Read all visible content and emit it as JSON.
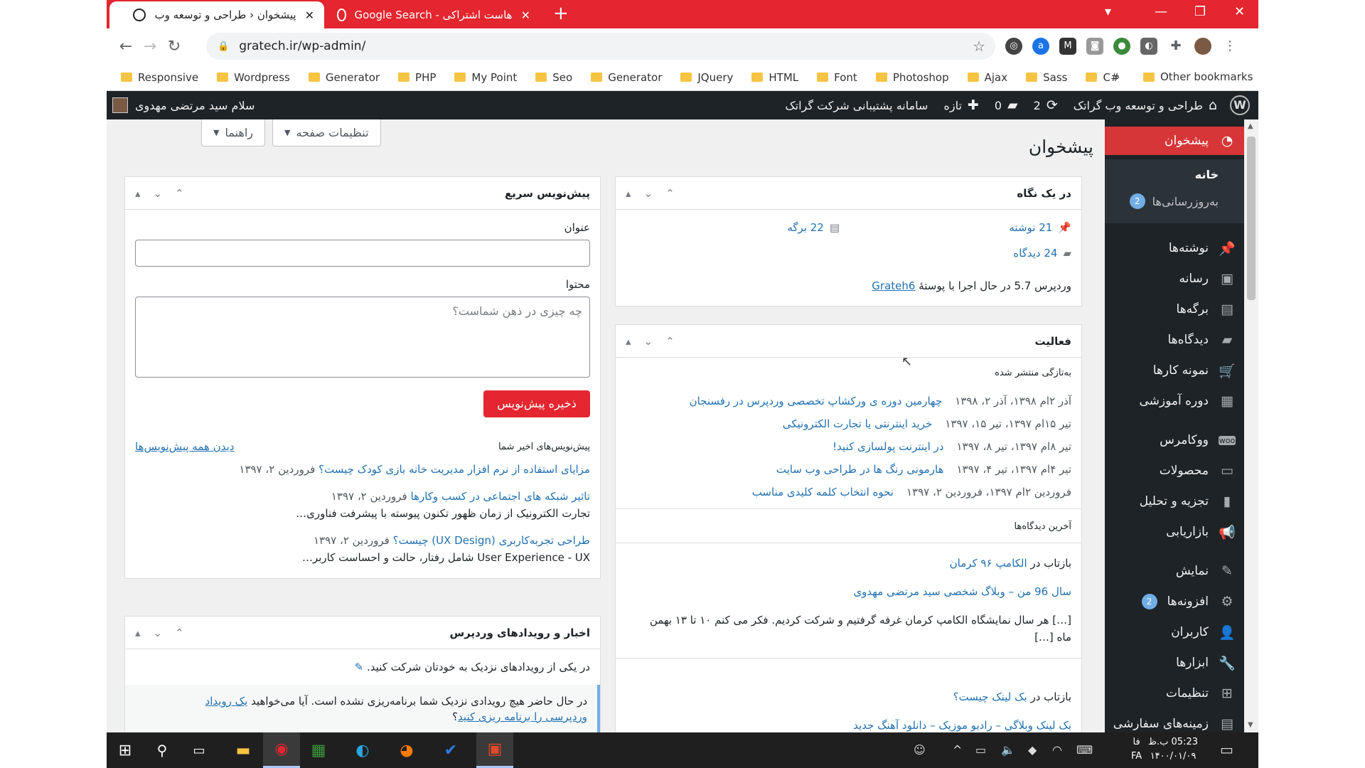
{
  "browser": {
    "tabs": [
      {
        "title": "پیشخوان ‹ طراحی و توسعه وب گراتک"
      },
      {
        "title": "هاست اشتراکی - Google Search"
      }
    ],
    "url": "gratech.ir/wp-admin/",
    "bookmarks": [
      "Responsive",
      "Wordpress",
      "Generator",
      "PHP",
      "My Point",
      "Seo",
      "Generator",
      "JQuery",
      "HTML",
      "Font",
      "Photoshop",
      "Ajax",
      "Sass",
      "C#"
    ],
    "bookmarks_more": "»",
    "other_bookmarks": "Other bookmarks"
  },
  "adminbar": {
    "site_name": "طراحی و توسعه وب گراتک",
    "updates_count": "2",
    "comments_count": "0",
    "new_label": "تازه",
    "support_label": "سامانه پشتیبانی شرکت گراتک",
    "greeting": "سلام سید مرتضی مهدوی"
  },
  "sidebar": {
    "dashboard": "پیشخوان",
    "home": "خانه",
    "updates": "به‌روزرسانی‌ها",
    "updates_badge": "2",
    "items": [
      {
        "label": "نوشته‌ها",
        "icon": "pin-icon",
        "glyph": "📌"
      },
      {
        "label": "رسانه",
        "icon": "media-icon",
        "glyph": "▣"
      },
      {
        "label": "برگه‌ها",
        "icon": "page-icon",
        "glyph": "▤"
      },
      {
        "label": "دیدگاه‌ها",
        "icon": "comment-icon",
        "glyph": "▰"
      },
      {
        "label": "نمونه کارها",
        "icon": "cart-icon",
        "glyph": "🛒"
      },
      {
        "label": "دوره آموزشی",
        "icon": "grid-icon",
        "glyph": "▦"
      },
      {
        "label": "ووکامرس",
        "icon": "woo-icon",
        "glyph": "woo"
      },
      {
        "label": "محصولات",
        "icon": "archive-icon",
        "glyph": "▭"
      },
      {
        "label": "تجزیه و تحلیل",
        "icon": "bar-chart-icon",
        "glyph": "▮"
      },
      {
        "label": "بازاریابی",
        "icon": "megaphone-icon",
        "glyph": "📢"
      },
      {
        "label": "نمایش",
        "icon": "brush-icon",
        "glyph": "✎"
      },
      {
        "label": "افزونه‌ها",
        "icon": "plugin-icon",
        "glyph": "⚙"
      },
      {
        "label": "کاربران",
        "icon": "user-icon",
        "glyph": "👤"
      },
      {
        "label": "ابزارها",
        "icon": "wrench-icon",
        "glyph": "🔧"
      },
      {
        "label": "تنظیمات",
        "icon": "settings-icon",
        "glyph": "⊞"
      },
      {
        "label": "زمینه‌های سفارشی",
        "icon": "table-icon",
        "glyph": "▤"
      }
    ],
    "plugins_badge": "2"
  },
  "screen": {
    "title": "پیشخوان",
    "screen_options": "تنظیمات صفحه",
    "help": "راهنما"
  },
  "glance": {
    "title": "در یک نگاه",
    "posts": "21 نوشته",
    "pages": "22 برگه",
    "comments": "24 دیدگاه",
    "wp_version_text": "وردپرس 5.7 در حال اجرا با پوستهٔ",
    "theme": "Grateh6"
  },
  "activity": {
    "title": "فعالیت",
    "recent_published": "به‌تازگی منتشر شده",
    "posts": [
      {
        "date": "آذر ۲ام ۱۳۹۸، آذر ۲، ۱۳۹۸",
        "title": "چهارمین دوره ی ورکشاپ تخصصی وردپرس در رفسنجان"
      },
      {
        "date": "تیر ۱۵ام ۱۳۹۷، تیر ۱۵، ۱۳۹۷",
        "title": "خرید اینترنتی یا تجارت الکترونیکی"
      },
      {
        "date": "تیر ۸ام ۱۳۹۷، تیر ۸، ۱۳۹۷",
        "title": "در اینترنت پولسازی کنید!"
      },
      {
        "date": "تیر ۴ام ۱۳۹۷، تیر ۴، ۱۳۹۷",
        "title": "هارمونی رنگ ها در طراحی وب سایت"
      },
      {
        "date": "فروردین ۲ام ۱۳۹۷، فروردین ۲، ۱۳۹۷",
        "title": "نحوه انتخاب کلمه کلیدی مناسب"
      }
    ],
    "recent_comments": "آخرین دیدگاه‌ها",
    "comment1_prefix": "بازتاب در",
    "comment1_post": "الکامپ ۹۶ کرمان",
    "comment1_author": "سال 96 من – وبلاگ شخصی سید مرتضی مهدوی",
    "comment1_excerpt_1": "[…] هر سال نمایشگاه الکامپ کرمان غرفه گرفتیم و شرکت کردیم. فکر می کنم ۱۰ تا ۱۳ بهمن",
    "comment1_excerpt_2": "ماه […]",
    "comment2_prefix": "بازتاب در",
    "comment2_post": "بک لینک چیست؟",
    "comment2_author": "بک لینک وبلاگی – رادیو موزیک – دانلود آهنگ جدید"
  },
  "quickdraft": {
    "title": "پیش‌نویس سریع",
    "title_label": "عنوان",
    "content_label": "محتوا",
    "content_placeholder": "چه چیزی در ذهن شماست؟",
    "save": "ذخیره پیش‌نویس",
    "recent_drafts": "پیش‌نویس‌های اخیر شما",
    "view_all": "دیدن همه پیش‌نویس‌ها",
    "drafts": [
      {
        "title": "مزایای استفاده از نرم افزار مدیریت خانه بازی کودک چیست؟",
        "date": "فروردین ۲، ۱۳۹۷",
        "excerpt": ""
      },
      {
        "title": "تاثیر شبکه های اجتماعی در کسب وکارها",
        "date": "فروردین ۲، ۱۳۹۷",
        "excerpt": "تجارت الکترونیک از زمان ظهور تکنون پیوسته با پیشرفت فناوری…"
      },
      {
        "title": "طراحی تجربه‌کاربری (UX Design) چیست؟",
        "date": "فروردین ۲، ۱۳۹۷",
        "excerpt": "User Experience - UX شامل رفتار، حالت و احساست کاربر…"
      }
    ]
  },
  "events": {
    "title": "اخبار و رویدادهای وردپرس",
    "attend": "در یکی از رویدادهای نزدیک به خودتان شرکت کنید.",
    "none_text": "در حال حاضر هیچ رویدادی نزدیک شما برنامه‌ریزی نشده است. آیا می‌خواهید",
    "none_link": "یک رویداد",
    "none_text2": "وردپرسی را برنامه ریزی کنید",
    "none_end": "؟"
  },
  "taskbar": {
    "time": "05:23 ب.ظ",
    "date": "۱۴۰۰/۰۱/۰۹",
    "lang_top": "فا",
    "lang": "FA"
  }
}
